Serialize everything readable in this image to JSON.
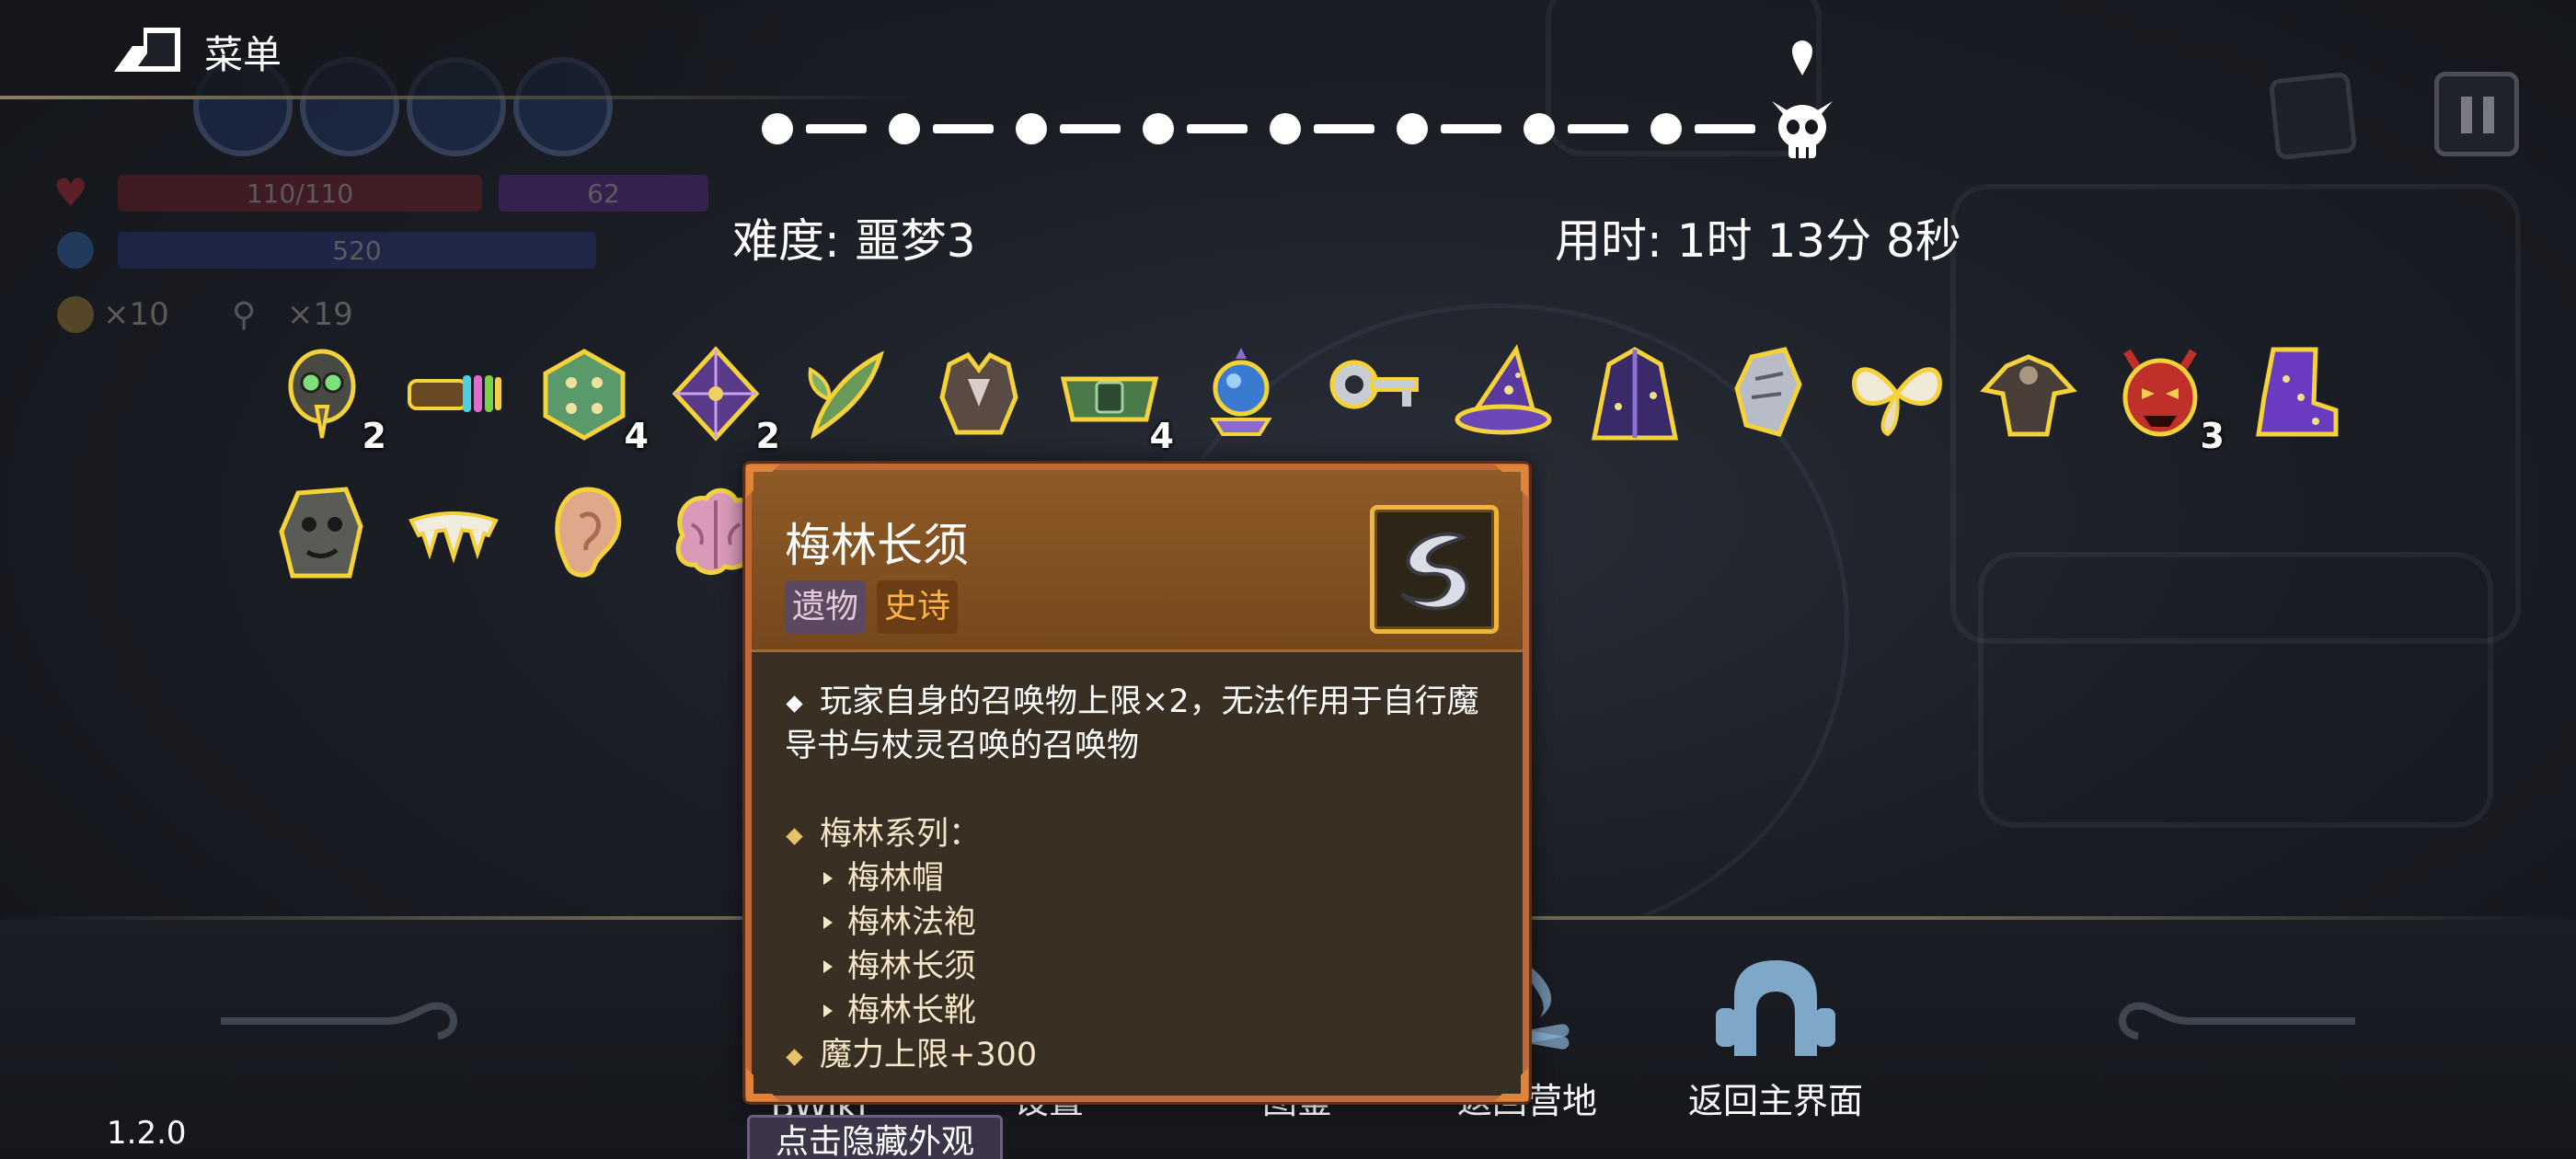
{
  "menu": {
    "label": "菜单"
  },
  "hud": {
    "health": "110/110",
    "shield": "62",
    "mana": "520",
    "coins": "×10",
    "keys": "×19"
  },
  "run": {
    "difficulty": "难度: 噩梦3",
    "time_used": "用时: 1时 13分 8秒",
    "progress_nodes": 8
  },
  "items_row1": [
    {
      "icon": "plague-mask-icon",
      "count": "2"
    },
    {
      "icon": "rainbow-bracelet-icon",
      "count": ""
    },
    {
      "icon": "green-dice-icon",
      "count": "4"
    },
    {
      "icon": "purple-dice-icon",
      "count": "2"
    },
    {
      "icon": "leaf-feather-icon",
      "count": ""
    },
    {
      "icon": "dark-armor-icon",
      "count": ""
    },
    {
      "icon": "green-belt-icon",
      "count": "4"
    },
    {
      "icon": "crystal-orb-icon",
      "count": ""
    },
    {
      "icon": "silver-key-icon",
      "count": ""
    },
    {
      "icon": "wizard-hat-icon",
      "count": ""
    },
    {
      "icon": "wizard-robe-icon",
      "count": ""
    },
    {
      "icon": "silver-gauntlet-icon",
      "count": ""
    },
    {
      "icon": "fairy-wings-icon",
      "count": ""
    },
    {
      "icon": "bat-cloak-icon",
      "count": ""
    },
    {
      "icon": "red-demon-mask-icon",
      "count": "3"
    },
    {
      "icon": "purple-boot-icon",
      "count": ""
    }
  ],
  "items_row2": [
    {
      "icon": "stone-face-icon",
      "count": ""
    },
    {
      "icon": "fangs-icon",
      "count": ""
    },
    {
      "icon": "ear-icon",
      "count": ""
    },
    {
      "icon": "brain-icon",
      "count": ""
    }
  ],
  "tooltip": {
    "title": "梅林长须",
    "tag_type": "遗物",
    "tag_rarity": "史诗",
    "desc_line1": "玩家自身的召唤物上限×2，无法作用于自行魔",
    "desc_line2": "导书与杖灵召唤的召唤物",
    "series_heading": "梅林系列：",
    "series_items": [
      "梅林帽",
      "梅林法袍",
      "梅林长须",
      "梅林长靴"
    ],
    "mana_bonus": "魔力上限+300",
    "icon": "merlin-beard-icon"
  },
  "bottom_buttons": [
    {
      "label": "BWiki"
    },
    {
      "label": "设置"
    },
    {
      "label": "图鉴"
    },
    {
      "label": "返回营地"
    },
    {
      "label": "返回主界面"
    }
  ],
  "hide_button": "点击隐藏外观",
  "version": "1.2.0",
  "colors": {
    "tooltip_border": "#c06a3a",
    "tooltip_header": "#8e5b26",
    "tag_epic_text": "#ffb44a",
    "item_outline": "#f4d23a"
  }
}
